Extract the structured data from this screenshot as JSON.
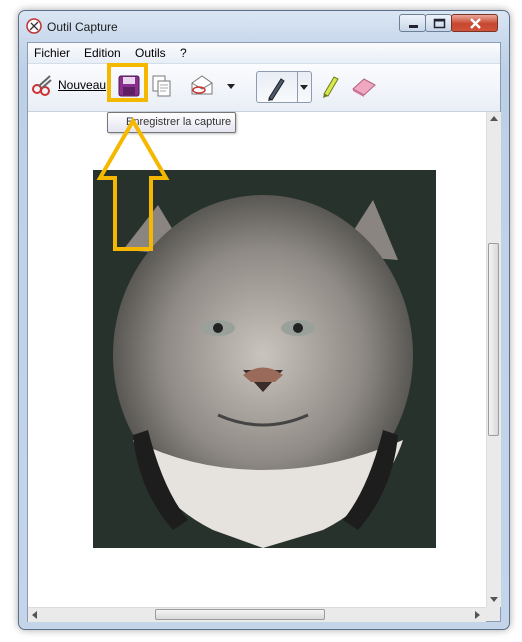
{
  "window": {
    "title": "Outil Capture"
  },
  "menu": {
    "items": [
      "Fichier",
      "Edition",
      "Outils",
      "?"
    ]
  },
  "toolbar": {
    "new_label": "Nouveau",
    "save_tooltip": "Enregistrer la capture"
  },
  "icons": {
    "app": "snipping-tool-icon",
    "new": "scissors-icon",
    "save": "floppy-disk-icon",
    "copy": "copy-icon",
    "send": "send-email-icon",
    "pen": "pen-icon",
    "highlighter": "highlighter-icon",
    "eraser": "eraser-icon"
  },
  "annotation": {
    "highlight_color": "#f5b800"
  },
  "capture": {
    "description_visible": false
  }
}
